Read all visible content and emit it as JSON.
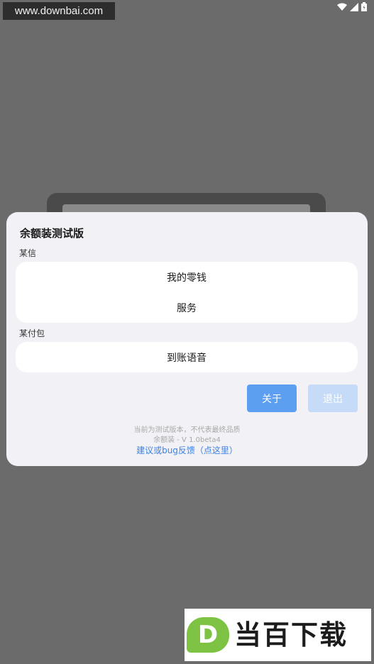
{
  "watermark": {
    "site": "www.downbai.com"
  },
  "status_bar": {
    "icons": [
      "wifi-icon",
      "signal-icon",
      "battery-icon"
    ]
  },
  "dialog": {
    "title": "余额装测试版",
    "sections": [
      {
        "label": "某信",
        "items": [
          "我的零钱",
          "服务"
        ]
      },
      {
        "label": "某付包",
        "items": [
          "到账语音"
        ]
      }
    ],
    "buttons": {
      "about": "关于",
      "exit": "退出"
    },
    "footer": {
      "note": "当前为测试版本，不代表最终品质",
      "version": "余额装 - V 1.0beta4",
      "feedback_link": "建议或bug反馈（点这里）"
    }
  },
  "logo": {
    "letter": "D",
    "text": "当百下载"
  },
  "colors": {
    "accent": "#5c9ef0",
    "accent_disabled": "#c6dbf7",
    "logo_green": "#7dc243",
    "link": "#3b82e6"
  }
}
